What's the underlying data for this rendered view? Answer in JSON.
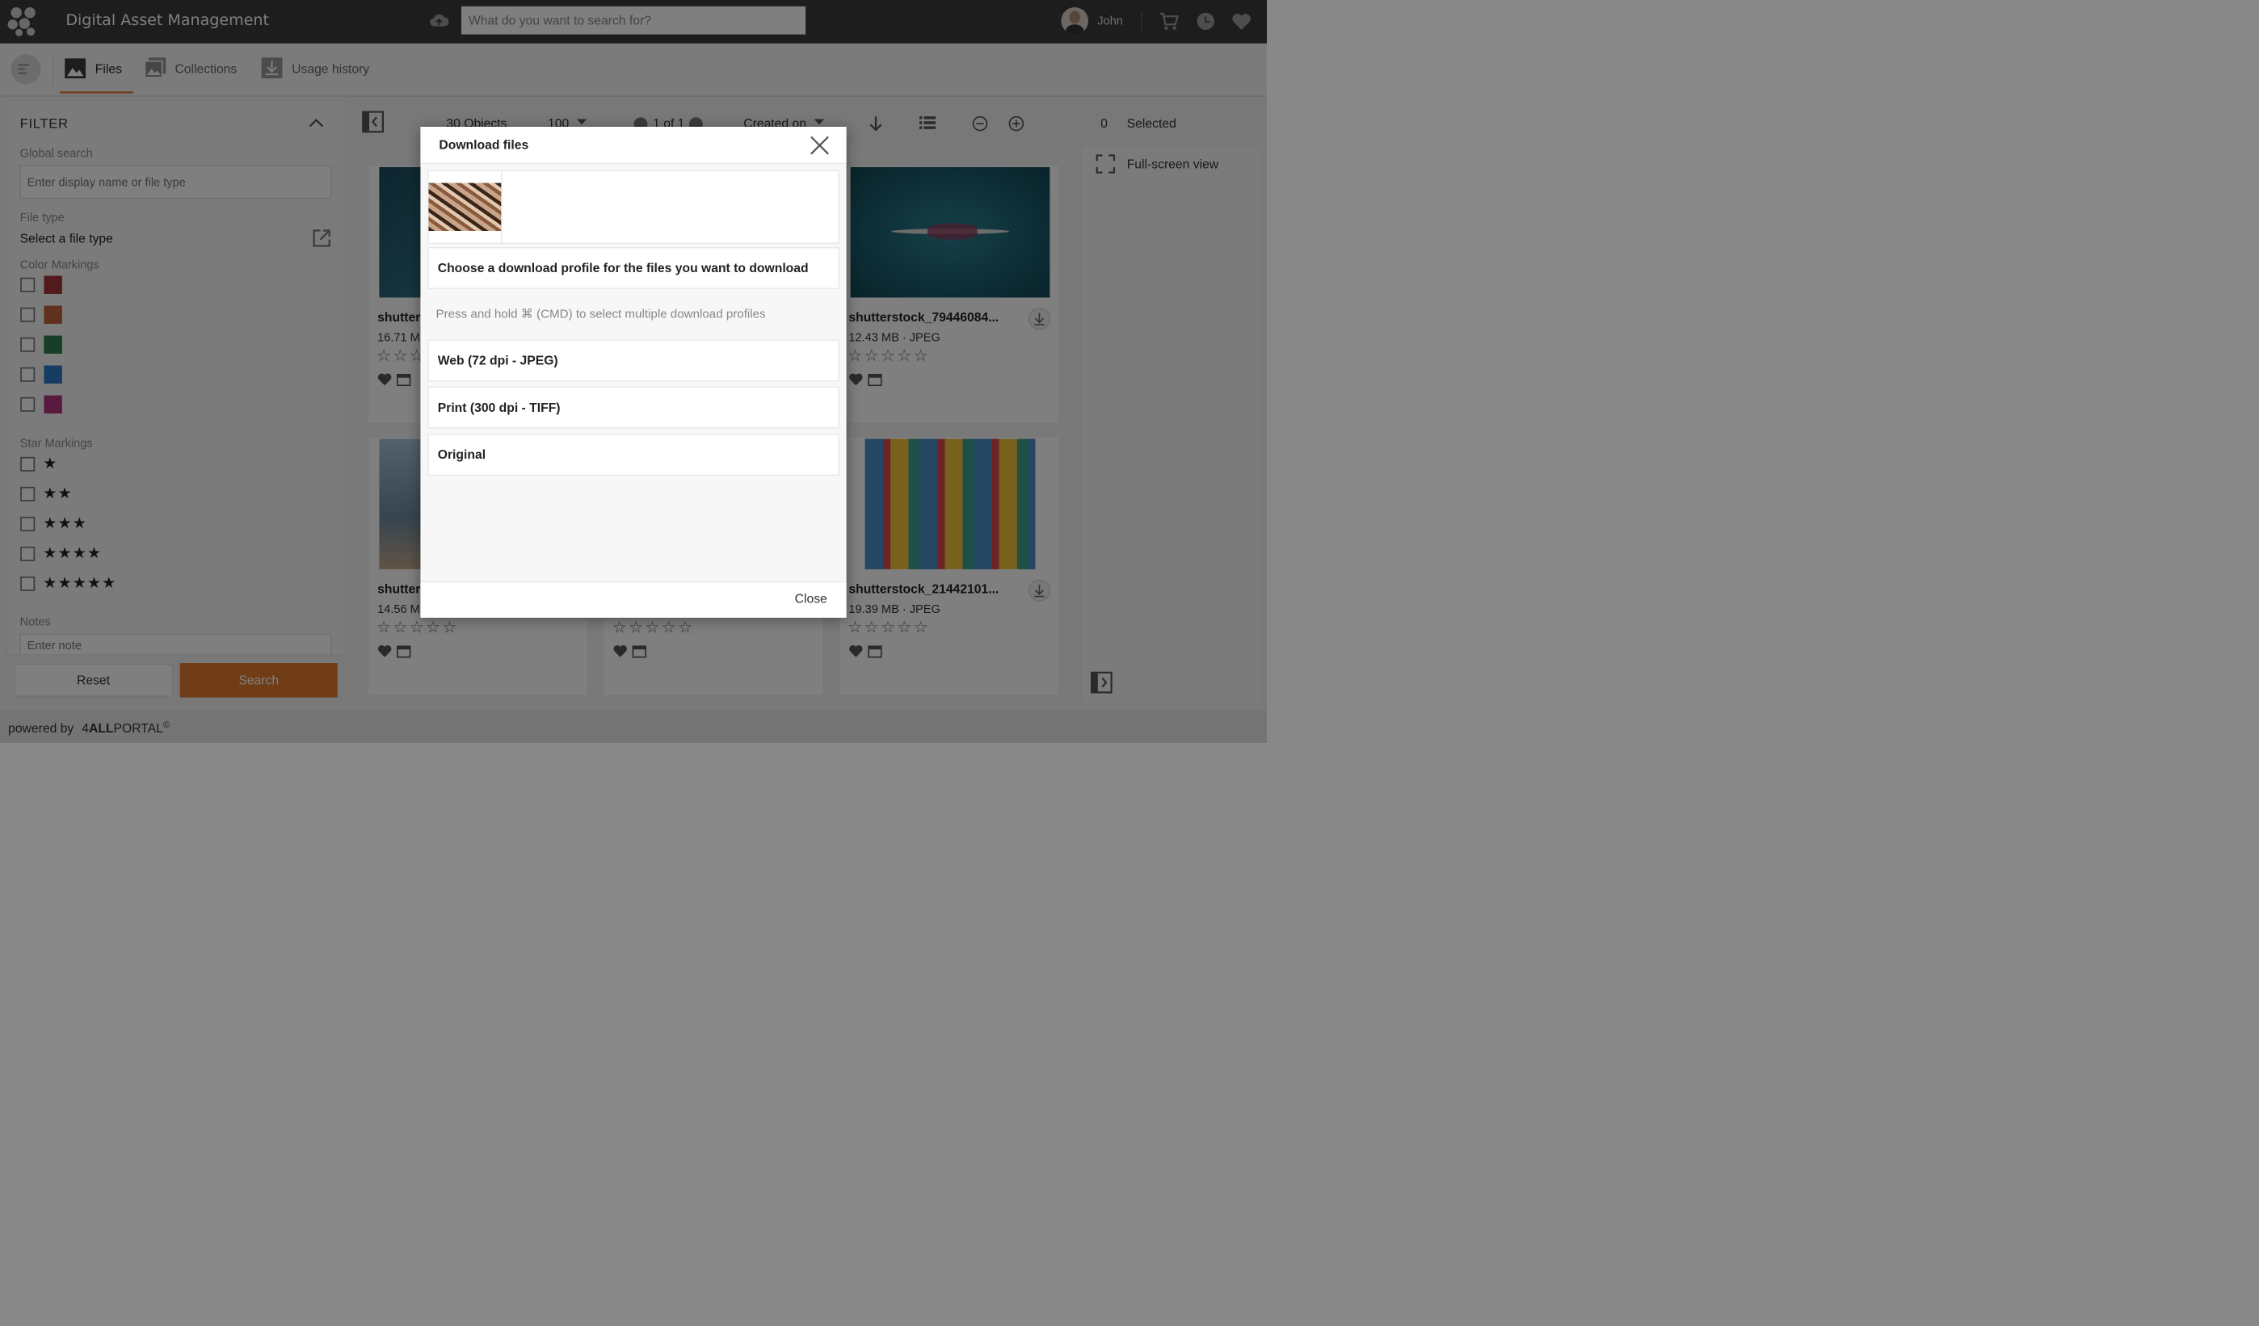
{
  "header": {
    "app_title": "Digital Asset Management",
    "search_placeholder": "What do you want to search for?",
    "user_name": "John"
  },
  "tabs": [
    {
      "label": "Files",
      "active": true
    },
    {
      "label": "Collections",
      "active": false
    },
    {
      "label": "Usage history",
      "active": false
    }
  ],
  "filter": {
    "title": "FILTER",
    "global_search_label": "Global search",
    "global_search_placeholder": "Enter display name or file type",
    "file_type_label": "File type",
    "file_type_value": "Select a file type",
    "color_markings_label": "Color Markings",
    "colors": [
      "#a6353a",
      "#c0643a",
      "#2e7d4f",
      "#2f78c4",
      "#b0347f"
    ],
    "star_markings_label": "Star Markings",
    "star_options": [
      "★",
      "★★",
      "★★★",
      "★★★★",
      "★★★★★"
    ],
    "notes_label": "Notes",
    "notes_placeholder": "Enter note",
    "reset_label": "Reset",
    "search_label": "Search"
  },
  "toolbar": {
    "objects_count": "30",
    "objects_label": "Objects",
    "page_size": "100",
    "pagination": "1 of 1",
    "sort_label": "Created on"
  },
  "cards": [
    {
      "name": "shutter",
      "meta": "16.71 M",
      "stars": "☆☆☆"
    },
    {
      "name": "",
      "meta": "",
      "stars": ""
    },
    {
      "name": "shutterstock_79446084...",
      "meta": "12.43 MB · JPEG",
      "stars": "☆☆☆☆☆"
    },
    {
      "name": "shutter",
      "meta": "14.56 M",
      "stars": "☆☆☆☆☆"
    },
    {
      "name": "",
      "meta": "",
      "stars": "☆☆☆☆☆"
    },
    {
      "name": "shutterstock_21442101...",
      "meta": "19.39 MB · JPEG",
      "stars": "☆☆☆☆☆"
    }
  ],
  "right_panel": {
    "selected_count": "0",
    "selected_label": "Selected",
    "fullscreen_label": "Full-screen view"
  },
  "footer": {
    "powered_by": "powered by",
    "brand_prefix": "4",
    "brand_bold": "ALL",
    "brand_rest": "PORTAL",
    "brand_mark": "©"
  },
  "modal": {
    "title": "Download files",
    "instruction": "Choose a download profile for the files you want to download",
    "hint": "Press and hold ⌘ (CMD) to select multiple download profiles",
    "profiles": [
      "Web (72 dpi - JPEG)",
      "Print (300 dpi - TIFF)",
      "Original"
    ],
    "close_label": "Close"
  },
  "colors": {
    "accent": "#e07b2c",
    "header_bg": "#3a3a3a"
  }
}
